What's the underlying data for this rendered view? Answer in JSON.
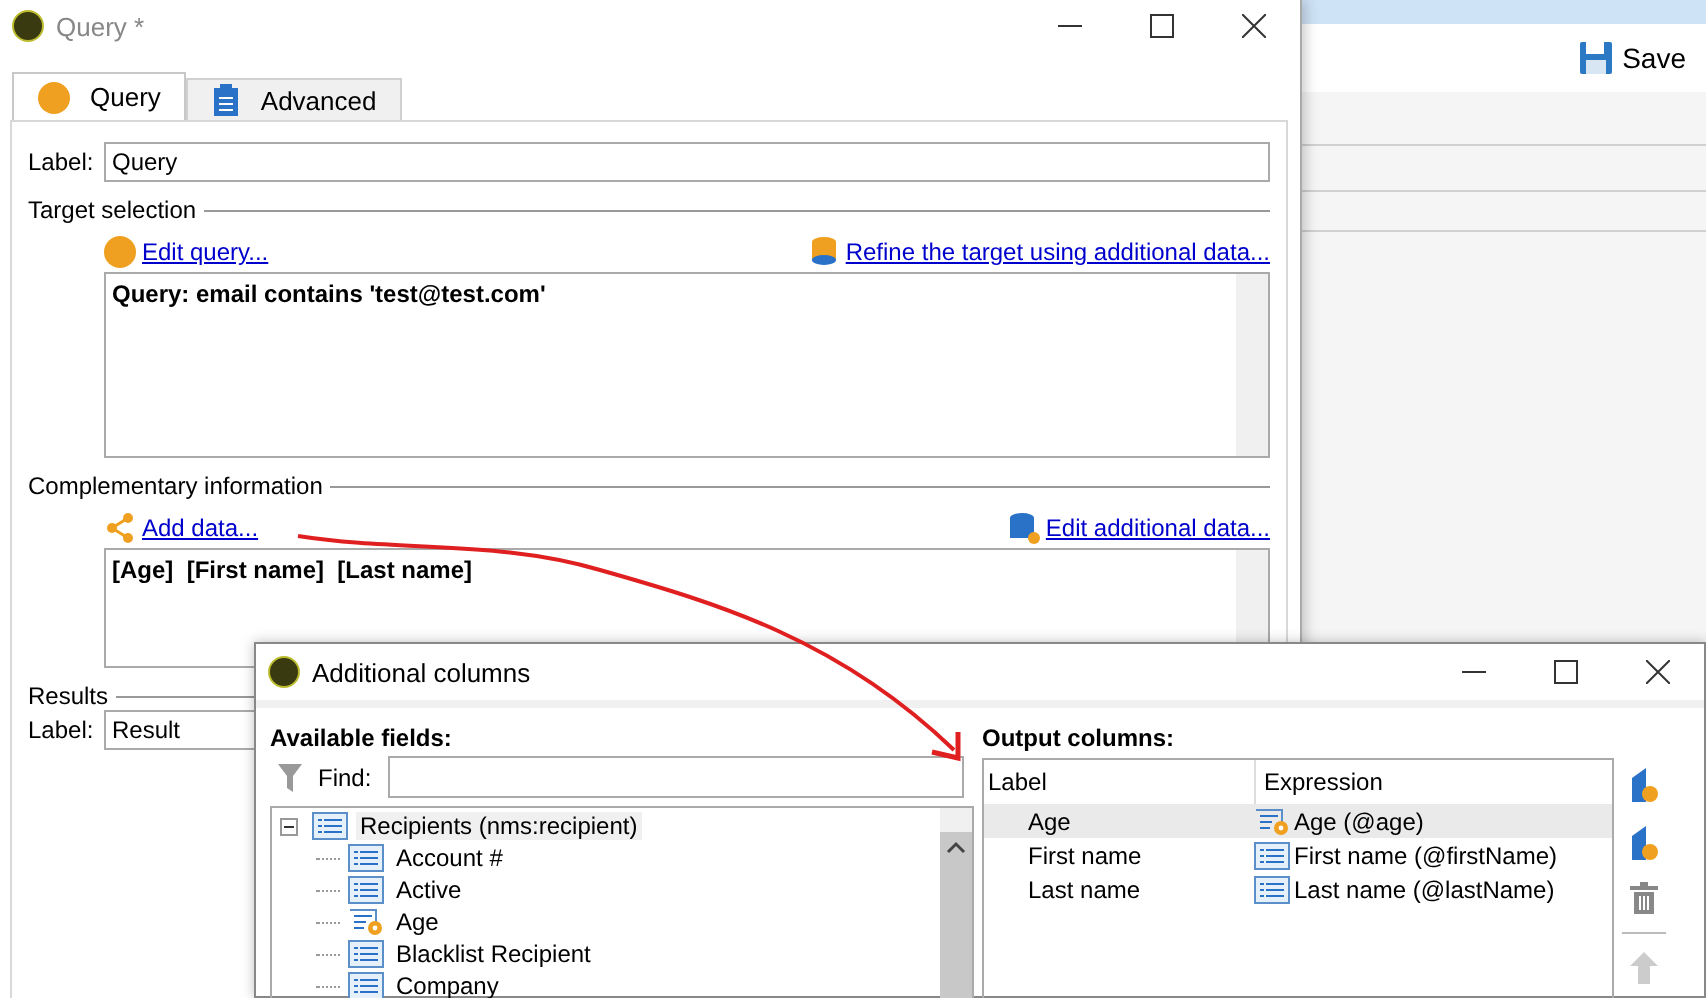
{
  "background_window": {
    "toolbar": {
      "save_label": "Save"
    }
  },
  "query_window": {
    "title": "Query *",
    "tabs": [
      {
        "label": "Query",
        "selected": true
      },
      {
        "label": "Advanced",
        "selected": false
      }
    ],
    "label_field": {
      "label": "Label:",
      "value": "Query"
    },
    "target_selection": {
      "heading": "Target selection",
      "edit_link": "Edit query...",
      "refine_link": "Refine the target using additional data...",
      "summary": "Query: email contains 'test@test.com'"
    },
    "complementary_information": {
      "heading": "Complementary information",
      "add_link": "Add data...",
      "edit_link": "Edit additional data...",
      "summary": "[Age]  [First name]  [Last name]"
    },
    "results": {
      "heading": "Results",
      "label": "Label:",
      "value": "Result"
    }
  },
  "additional_columns_window": {
    "title": "Additional columns",
    "available_fields": {
      "heading": "Available fields:",
      "find_label": "Find:",
      "tree": [
        {
          "label": "Recipients (nms:recipient)",
          "kind": "table",
          "selected": true,
          "expanded": true,
          "children": [
            {
              "label": "Account #",
              "kind": "field",
              "selected": false
            },
            {
              "label": "Active",
              "kind": "field",
              "selected": false
            },
            {
              "label": "Age",
              "kind": "computed",
              "selected": false
            },
            {
              "label": "Blacklist Recipient",
              "kind": "field",
              "selected": false
            },
            {
              "label": "Company",
              "kind": "field",
              "selected": false
            }
          ]
        }
      ]
    },
    "output_columns": {
      "heading": "Output columns:",
      "columns": [
        "Label",
        "Expression"
      ],
      "rows": [
        {
          "label": "Age",
          "expression": "Age (@age)",
          "kind": "computed",
          "selected": true
        },
        {
          "label": "First name",
          "expression": "First name (@firstName)",
          "kind": "field",
          "selected": false
        },
        {
          "label": "Last name",
          "expression": "Last name (@lastName)",
          "kind": "field",
          "selected": false
        }
      ]
    }
  }
}
